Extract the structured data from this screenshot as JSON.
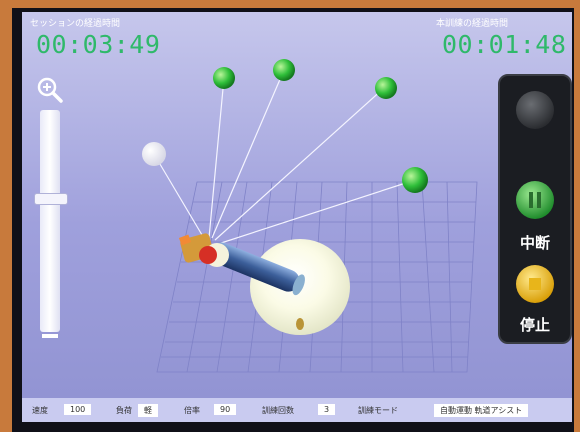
{
  "session": {
    "label": "セッションの経過時間",
    "time": "00:03:49"
  },
  "training": {
    "label": "本訓練の経過時間",
    "time": "00:01:48"
  },
  "controls": {
    "pause_label": "中断",
    "stop_label": "停止"
  },
  "status": {
    "speed_label": "速度",
    "speed_value": "100",
    "load_label": "負荷",
    "load_value": "軽",
    "ratio_label": "倍率",
    "ratio_value": "90",
    "count_label": "訓練回数",
    "count_value": "3",
    "mode_label": "訓練モード",
    "mode_value": "自動運動 軌道アシスト"
  },
  "colors": {
    "timer": "#2fb96a",
    "target_green": "#2fbf3a",
    "pause_green": "#35b84a",
    "stop_yellow": "#f2c418"
  },
  "icons": {
    "zoom": "zoom-in-icon",
    "pause": "pause-icon",
    "stop": "stop-icon"
  }
}
